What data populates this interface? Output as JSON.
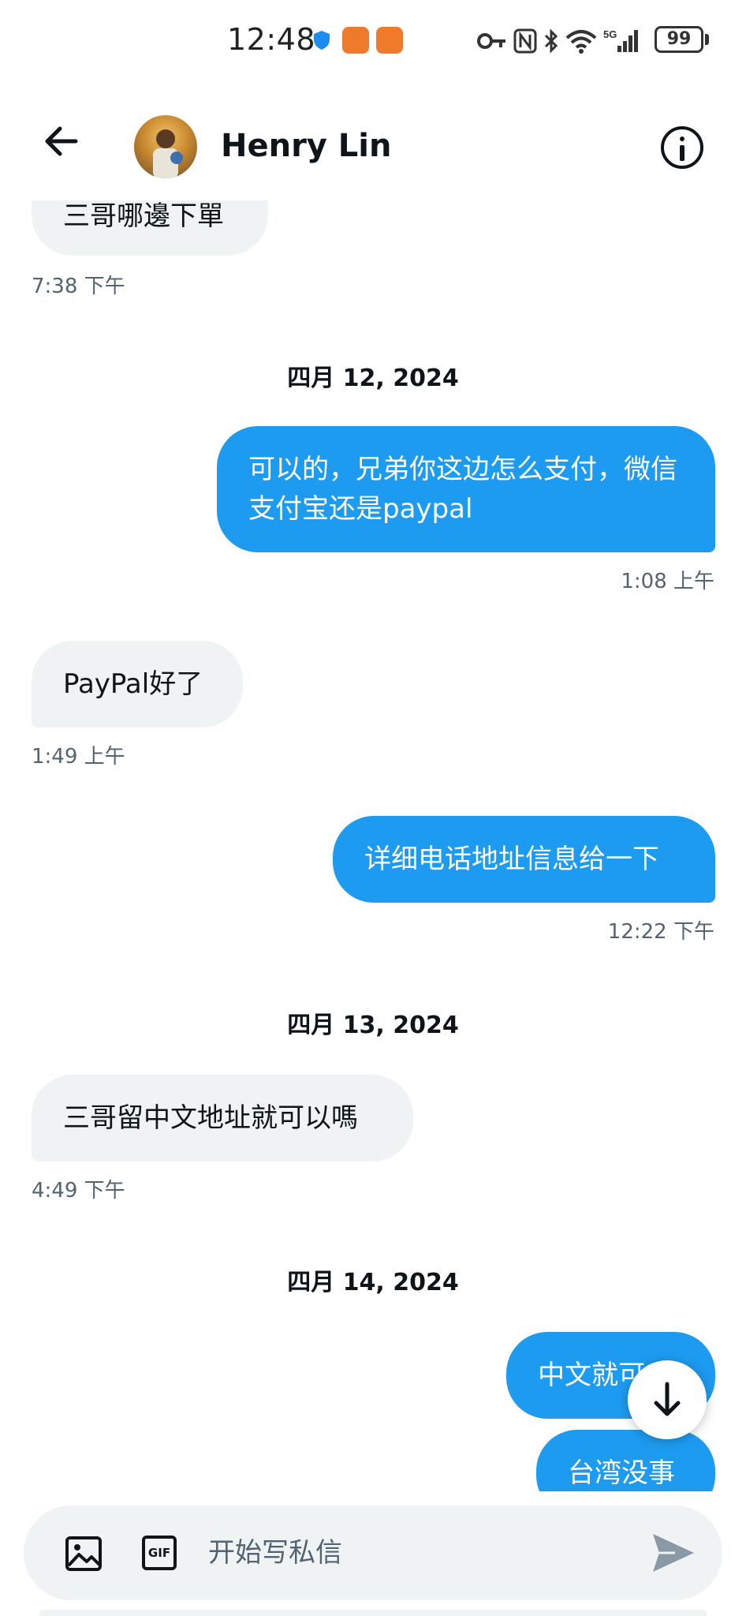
{
  "status_bar": {
    "time": "12:48",
    "network": "5G",
    "battery": "99"
  },
  "header": {
    "name": "Henry Lin"
  },
  "messages": [
    {
      "direction": "incoming",
      "text": "三哥哪邊下單",
      "time": "7:38 下午"
    },
    {
      "date": "四月 12, 2024"
    },
    {
      "direction": "outgoing",
      "text": "可以的，兄弟你这边怎么支付，微信支付宝还是paypal",
      "time": "1:08 上午"
    },
    {
      "direction": "incoming",
      "text": "PayPal好了",
      "time": "1:49 上午"
    },
    {
      "direction": "outgoing",
      "text": "详细电话地址信息给一下",
      "time": "12:22 下午"
    },
    {
      "date": "四月 13, 2024"
    },
    {
      "direction": "incoming",
      "text": "三哥留中文地址就可以嗎",
      "time": "4:49 下午"
    },
    {
      "date": "四月 14, 2024"
    },
    {
      "direction": "outgoing",
      "text": "中文就可"
    },
    {
      "direction": "outgoing",
      "text": "台湾没事"
    }
  ],
  "composer": {
    "placeholder": "开始写私信",
    "gif_label": "GIF"
  },
  "colors": {
    "outgoing_bubble": "#1d9bf0",
    "incoming_bubble": "#eff3f4",
    "secondary_text": "#536471"
  }
}
